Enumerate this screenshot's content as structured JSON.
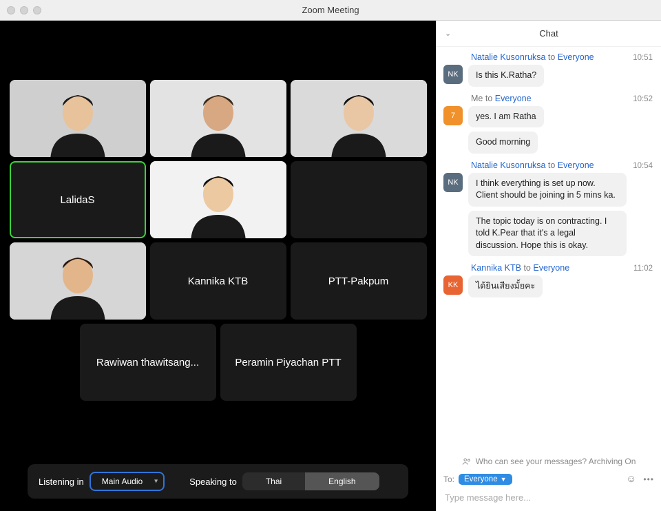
{
  "window": {
    "title": "Zoom Meeting"
  },
  "participants": [
    {
      "name": "",
      "video": true
    },
    {
      "name": "",
      "video": true
    },
    {
      "name": "",
      "video": true
    },
    {
      "name": "LalidaS",
      "video": false,
      "speaking": true
    },
    {
      "name": "",
      "video": true
    },
    {
      "name": "",
      "video": false,
      "blank": true
    },
    {
      "name": "",
      "video": true
    },
    {
      "name": "Kannika KTB",
      "video": false
    },
    {
      "name": "PTT-Pakpum",
      "video": false
    },
    {
      "name": "Rawiwan thawitsang...",
      "video": false
    },
    {
      "name": "Peramin Piyachan PTT",
      "video": false
    }
  ],
  "lang": {
    "listening_label": "Listening in",
    "listening_value": "Main Audio",
    "speaking_label": "Speaking to",
    "option_a": "Thai",
    "option_b": "English"
  },
  "chat": {
    "title": "Chat",
    "to_word": "to",
    "everyone_word": "Everyone",
    "me_word": "Me",
    "groups": [
      {
        "sender": "Natalie Kusonruksa",
        "self": false,
        "time": "10:51",
        "avatar": "NK",
        "avatar_class": "nk",
        "messages": [
          "Is this K.Ratha?"
        ]
      },
      {
        "sender": "Me",
        "self": true,
        "time": "10:52",
        "avatar": "7",
        "avatar_class": "me",
        "messages": [
          "yes. I am Ratha",
          "Good morning"
        ]
      },
      {
        "sender": "Natalie Kusonruksa",
        "self": false,
        "time": "10:54",
        "avatar": "NK",
        "avatar_class": "nk",
        "messages": [
          "I think everything is set up now. Client should be joining in 5 mins ka.",
          "The topic today is on contracting. I told K.Pear that it's a legal discussion. Hope this is okay."
        ]
      },
      {
        "sender": "Kannika KTB",
        "self": false,
        "time": "11:02",
        "avatar": "KK",
        "avatar_class": "kk",
        "messages": [
          "ได้ยินเสียงมั้ยคะ"
        ]
      }
    ],
    "footer_info": "Who can see your messages? Archiving On",
    "to_label": "To:",
    "to_value": "Everyone",
    "input_placeholder": "Type message here..."
  }
}
